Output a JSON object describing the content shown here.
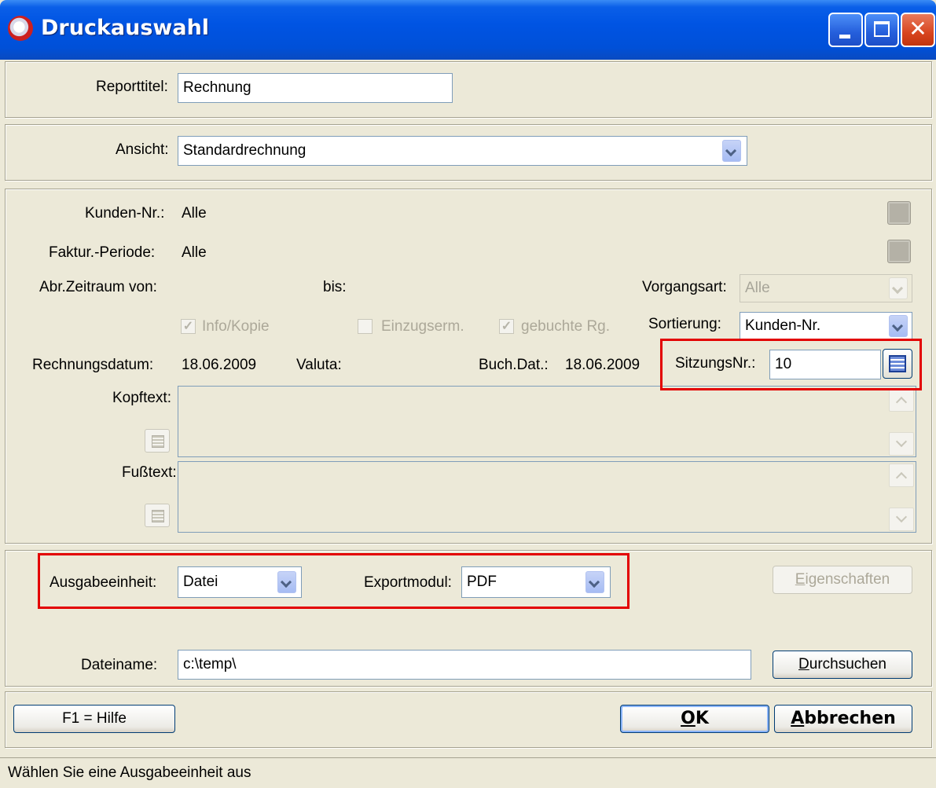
{
  "window": {
    "title": "Druckauswahl"
  },
  "report": {
    "label": "Reporttitel:",
    "value": "Rechnung"
  },
  "ansicht": {
    "label": "Ansicht:",
    "value": "Standardrechnung"
  },
  "filters": {
    "kunden_label": "Kunden-Nr.:",
    "kunden_value": "Alle",
    "faktur_label": "Faktur.-Periode:",
    "faktur_value": "Alle",
    "abr_von_label": "Abr.Zeitraum von:",
    "abr_bis_label": "bis:",
    "vorgangsart_label": "Vorgangsart:",
    "vorgangsart_value": "Alle",
    "info_kopie_label": "Info/Kopie",
    "info_kopie_checked": true,
    "einzug_label": "Einzugserm.",
    "einzug_checked": false,
    "gebucht_label": "gebuchte Rg.",
    "gebucht_checked": true,
    "sortierung_label": "Sortierung:",
    "sortierung_value": "Kunden-Nr.",
    "rechnungsdatum_label": "Rechnungsdatum:",
    "rechnungsdatum_value": "18.06.2009",
    "valuta_label": "Valuta:",
    "buchdat_label": "Buch.Dat.:",
    "buchdat_value": "18.06.2009",
    "sitzung_label": "SitzungsNr.:",
    "sitzung_value": "10",
    "kopftext_label": "Kopftext:",
    "fusstext_label": "Fußtext:"
  },
  "output": {
    "ausgabe_label": "Ausgabeeinheit:",
    "ausgabe_value": "Datei",
    "export_label": "Exportmodul:",
    "export_value": "PDF",
    "eigenschaften_pre": "",
    "eigenschaften_u": "E",
    "eigenschaften_rest": "igenschaften",
    "dateiname_label": "Dateiname:",
    "dateiname_value": "c:\\temp\\",
    "durchsuchen_u": "D",
    "durchsuchen_rest": "urchsuchen"
  },
  "buttons": {
    "hilfe": "F1 = Hilfe",
    "ok_u": "O",
    "ok_rest": "K",
    "abbrechen_u": "A",
    "abbrechen_rest": "bbrechen"
  },
  "status": {
    "text": "Wählen Sie eine Ausgabeeinheit aus"
  },
  "colors": {
    "highlight": "#e30000",
    "titlebar": "#0054e3",
    "dialog_bg": "#ece9d8"
  }
}
